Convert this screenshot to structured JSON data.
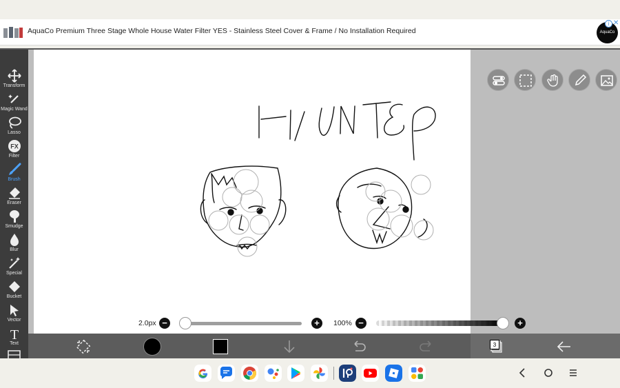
{
  "ad": {
    "text": "AquaCo Premium Three Stage Whole House Water Filter YES - Stainless Steel Cover & Frame / No Installation Required",
    "logo_text": "AquaCo",
    "info_label": "i",
    "close_label": "✕"
  },
  "toolbar": {
    "tools": [
      {
        "label": "Transform",
        "icon": "transform-icon"
      },
      {
        "label": "Magic Wand",
        "icon": "magic-wand-icon"
      },
      {
        "label": "Lasso",
        "icon": "lasso-icon"
      },
      {
        "label": "Filter",
        "icon": "filter-icon"
      },
      {
        "label": "Brush",
        "icon": "brush-icon",
        "active": true
      },
      {
        "label": "Eraser",
        "icon": "eraser-icon"
      },
      {
        "label": "Smudge",
        "icon": "smudge-icon"
      },
      {
        "label": "Blur",
        "icon": "blur-icon"
      },
      {
        "label": "Special",
        "icon": "special-icon"
      },
      {
        "label": "Bucket",
        "icon": "bucket-icon"
      },
      {
        "label": "Vector",
        "icon": "vector-icon"
      },
      {
        "label": "Text",
        "icon": "text-icon"
      }
    ],
    "filter_icon_text": "FX",
    "text_icon_text": "T",
    "active_color": "#4da3ff"
  },
  "canvas": {
    "drawing_text": "HUNTER"
  },
  "brush": {
    "size_label": "2.0px",
    "size_value": 2.0,
    "opacity_label": "100%",
    "opacity_value": 100,
    "minus": "−",
    "plus": "+"
  },
  "bottom_bar": {
    "layer_count": "3",
    "primary_color": "#000000"
  },
  "dock": {
    "apps": [
      "Google",
      "Messages",
      "Chrome",
      "Assistant",
      "Play Store",
      "Photos",
      "ibisPaint",
      "YouTube",
      "Roblox",
      "Apps"
    ]
  }
}
